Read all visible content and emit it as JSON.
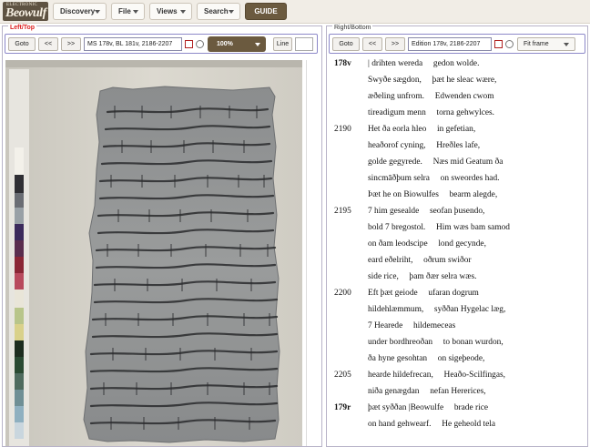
{
  "app": {
    "logo_small": "ELECTRONIC",
    "logo_big": "Beowulf"
  },
  "menu": [
    {
      "label": "Discovery"
    },
    {
      "label": "File"
    },
    {
      "label": "Views"
    },
    {
      "label": "Search"
    }
  ],
  "guide_label": "GUIDE",
  "left_panel": {
    "legend": "Left/Top",
    "goto_label": "Goto",
    "prev_label": "<<",
    "next_label": ">>",
    "location_value": "MS 178v, BL 181v, 2186-2207",
    "zoom_value": "100%",
    "line_label": "Line"
  },
  "right_panel": {
    "legend": "Right/Bottom",
    "goto_label": "Goto",
    "prev_label": "<<",
    "next_label": ">>",
    "location_value": "Edition 178v, 2186-2207",
    "fit_value": "Fit frame"
  },
  "edition_lines": [
    {
      "num": "178v",
      "bold": true,
      "text": "| drihten wereda     gedon wolde."
    },
    {
      "num": "",
      "bold": false,
      "text": "Swyðe sægdon,     þæt he sleac wære,"
    },
    {
      "num": "",
      "bold": false,
      "text": "æðeling unfrom.     Edwenden cwom"
    },
    {
      "num": "",
      "bold": false,
      "text": "tireadigum menn     torna gehwylces."
    },
    {
      "num": "2190",
      "bold": false,
      "text": "Het ða eorla hleo     in gefetian,"
    },
    {
      "num": "",
      "bold": false,
      "text": "heaðorof cyning,     Hreðles lafe,"
    },
    {
      "num": "",
      "bold": false,
      "text": "golde gegyrede.     Næs mid Geatum ða"
    },
    {
      "num": "",
      "bold": false,
      "text": "sincmāðþum selra     on sweordes had."
    },
    {
      "num": "",
      "bold": false,
      "text": "Þæt he on Biowulfes     bearm alegde,"
    },
    {
      "num": "2195",
      "bold": false,
      "text": "7 him gesealde     seofan þusendo,"
    },
    {
      "num": "",
      "bold": false,
      "text": "bold 7 bregostol.     Him wæs bam samod"
    },
    {
      "num": "",
      "bold": false,
      "text": "on ðam leodscipe     lond gecynde,"
    },
    {
      "num": "",
      "bold": false,
      "text": "eard eðelriht,     oðrum swiðor"
    },
    {
      "num": "",
      "bold": false,
      "text": "side rice,     þam ðær selra wæs."
    },
    {
      "num": "2200",
      "bold": false,
      "text": "Eft þæt geiode     ufaran dogrum"
    },
    {
      "num": "",
      "bold": false,
      "text": "hildehlæmmum,     syððan Hygelac læg,"
    },
    {
      "num": "",
      "bold": false,
      "text": "7 Hearede     hildemeceas"
    },
    {
      "num": "",
      "bold": false,
      "text": "under bordhreoðan     to bonan wurdon,"
    },
    {
      "num": "",
      "bold": false,
      "text": "ða hyne gesohtan     on sigeþeode,"
    },
    {
      "num": "2205",
      "bold": false,
      "text": "hearde hildefrecan,     Heaðo-Scilfingas,"
    },
    {
      "num": "",
      "bold": false,
      "text": "niða genægdan     nefan Hererices,"
    },
    {
      "num": "179r",
      "bold": true,
      "text": "þæt syððan |Beowulfe     brade rice"
    },
    {
      "num": "",
      "bold": false,
      "text": "on hand gehwearf.     He geheold tela"
    }
  ]
}
